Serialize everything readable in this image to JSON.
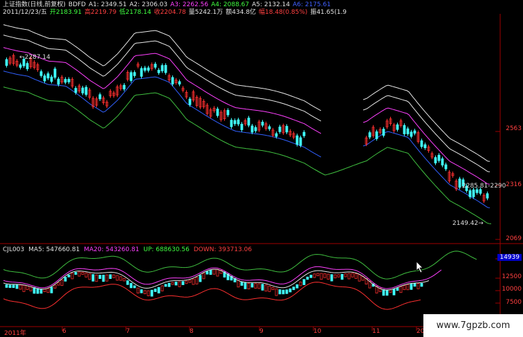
{
  "header": {
    "line1": [
      {
        "text": "上证指数(日线,前复权)",
        "color": "#e0e0e0"
      },
      {
        "text": "BDFD",
        "color": "#e0e0e0"
      },
      {
        "text": "A1: 2349.51",
        "color": "#e0e0e0"
      },
      {
        "text": "A2: 2306.03",
        "color": "#e0e0e0"
      },
      {
        "text": "A3: 2262.56",
        "color": "#ff40ff"
      },
      {
        "text": "A4: 2088.67",
        "color": "#40ff40"
      },
      {
        "text": "A5: 2132.14",
        "color": "#e0e0e0"
      },
      {
        "text": "A6: 2175.61",
        "color": "#4060ff"
      }
    ],
    "line2": [
      {
        "text": "2011/12/23/五",
        "color": "#e0e0e0"
      },
      {
        "text": "开2183.91",
        "color": "#40ff40"
      },
      {
        "text": "高2219.79",
        "color": "#ff4040"
      },
      {
        "text": "低2178.14",
        "color": "#40ff40"
      },
      {
        "text": "收2204.78",
        "color": "#ff4040"
      },
      {
        "text": "量5242.1万",
        "color": "#e0e0e0"
      },
      {
        "text": "额434.8亿",
        "color": "#e0e0e0"
      },
      {
        "text": "幅18.48(0.85%)",
        "color": "#ff4040"
      },
      {
        "text": "振41.65(1.9",
        "color": "#e0e0e0"
      }
    ]
  },
  "price_axis": {
    "labels": [
      "2563",
      "2316",
      "2069"
    ]
  },
  "price_annotations": {
    "high": "2287.14",
    "mid": "2285.81-2290",
    "low": "2149.42"
  },
  "sub_indicator": {
    "name": "CJL003",
    "items": [
      {
        "text": "MA5: 547660.81",
        "color": "#e0e0e0"
      },
      {
        "text": "MA20: 543260.81",
        "color": "#ff40ff"
      },
      {
        "text": "UP: 688630.56",
        "color": "#40ff40"
      },
      {
        "text": "DOWN: 393713.06",
        "color": "#ff4040"
      }
    ],
    "axis_labels": [
      "14939",
      "12500",
      "10000",
      "7500"
    ]
  },
  "x_axis": {
    "labels": [
      "2011年",
      "6",
      "7",
      "8",
      "9",
      "10",
      "11",
      "20"
    ]
  },
  "watermark": "www.7gpzb.com",
  "colors": {
    "up": "#ff3030",
    "down": "#40ffff",
    "frame": "#a00000",
    "env_outer": "#e8e8e8",
    "env_mid": "#ff40ff",
    "env_inner": "#3060ff",
    "env_low": "#40c040"
  },
  "chart_data": {
    "type": "candlestick",
    "y_range_price": [
      2069,
      2563
    ],
    "visible_price_labels": [
      "2563",
      "2316",
      "2069"
    ]
  }
}
